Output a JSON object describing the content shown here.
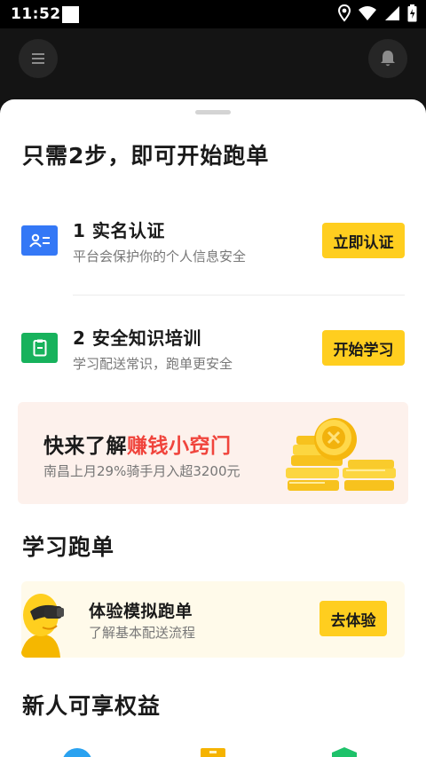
{
  "status_bar": {
    "time": "11:52",
    "icons": [
      "notification-square-icon",
      "location-icon",
      "wifi-icon",
      "signal-icon",
      "battery-icon"
    ]
  },
  "top_bar": {
    "menu_icon": "menu-icon",
    "bell_icon": "bell-icon"
  },
  "sheet": {
    "title": "只需2步，即可开始跑单",
    "steps": [
      {
        "icon": "id-card-icon",
        "icon_color": "#3478f6",
        "title": "1 实名认证",
        "desc": "平台会保护你的个人信息安全",
        "button": "立即认证"
      },
      {
        "icon": "document-icon",
        "icon_color": "#17b25c",
        "title": "2 安全知识培训",
        "desc": "学习配送常识，跑单更安全",
        "button": "开始学习"
      }
    ],
    "banner": {
      "title_prefix": "快来了解",
      "title_highlight": "赚钱小窍门",
      "desc": "南昌上月29%骑手月入超3200元",
      "image": "gold-coins-illustration"
    },
    "learn_section": {
      "title": "学习跑单",
      "card": {
        "title": "体验模拟跑单",
        "desc": "了解基本配送流程",
        "button": "去体验",
        "image": "rider-vr-illustration"
      }
    },
    "benefits_section": {
      "title": "新人可享权益",
      "icons": [
        "blue-benefit-icon",
        "yellow-benefit-icon",
        "green-benefit-icon"
      ]
    }
  },
  "colors": {
    "accent": "#ffce1f",
    "highlight_red": "#f0443c",
    "blue": "#3478f6",
    "green": "#17b25c"
  }
}
